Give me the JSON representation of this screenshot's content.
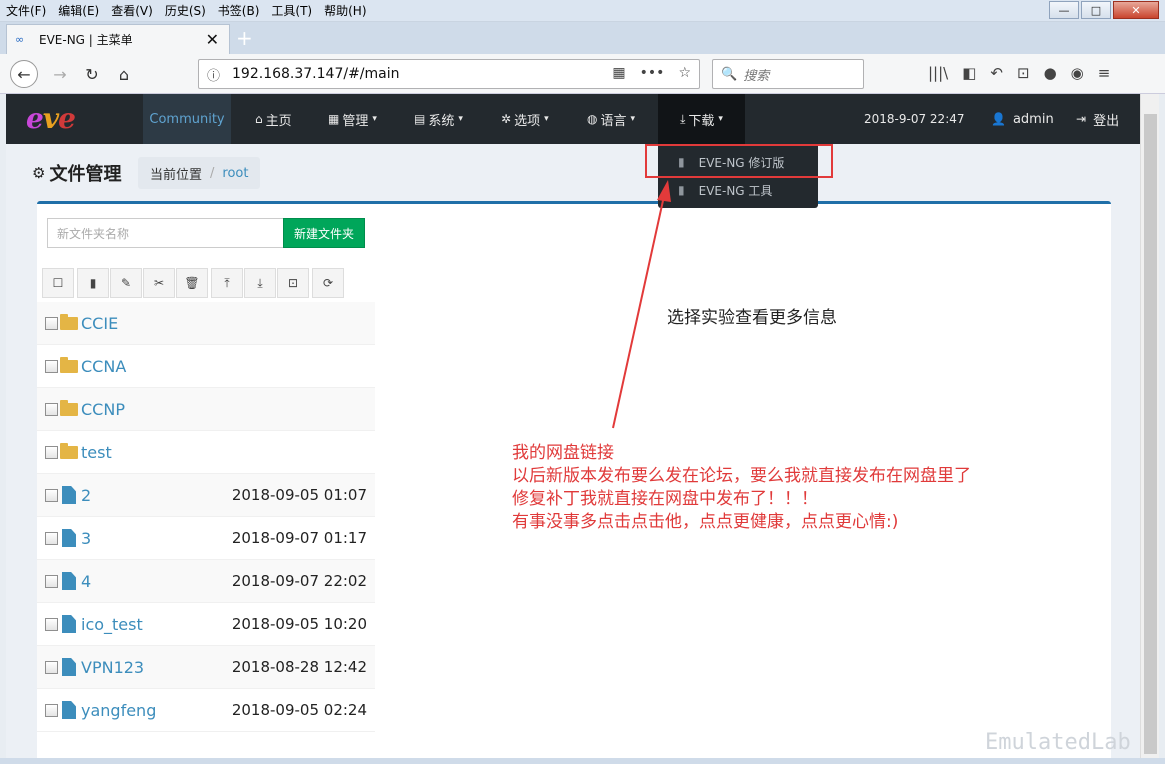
{
  "browser": {
    "menu": [
      "文件(F)",
      "编辑(E)",
      "查看(V)",
      "历史(S)",
      "书签(B)",
      "工具(T)",
      "帮助(H)"
    ],
    "window_controls": [
      "—",
      "□",
      "✕"
    ],
    "tab_title": "EVE-NG | 主菜单",
    "tab_close": "✕",
    "new_tab": "+",
    "url": "192.168.37.147/#/main",
    "search_placeholder": "搜索",
    "url_icons": [
      "▦",
      "•••",
      "☆"
    ],
    "tool_icons": [
      "|||\\",
      "◧",
      "↶",
      "⊡",
      "●",
      "◉",
      "≡"
    ]
  },
  "app": {
    "logo": [
      "e",
      "v",
      "e"
    ],
    "community": "Community",
    "nav": [
      {
        "icon": "⌂",
        "label": "主页"
      },
      {
        "icon": "▦",
        "label": "管理"
      },
      {
        "icon": "▤",
        "label": "系统"
      },
      {
        "icon": "✲",
        "label": "选项"
      },
      {
        "icon": "◍",
        "label": "语言"
      },
      {
        "icon": "⤓",
        "label": "下载"
      }
    ],
    "caret": "▾",
    "datetime": "2018-9-07   22:47",
    "user": "admin",
    "logout": "登出",
    "user_icon": "👤",
    "logout_icon": "⇥",
    "dropdown": [
      "EVE-NG 修订版",
      "EVE-NG 工具"
    ]
  },
  "filemanager": {
    "title": "文件管理",
    "breadcrumb_label": "当前位置",
    "breadcrumb_sep": "/",
    "breadcrumb_root": "root",
    "new_folder_placeholder": "新文件夹名称",
    "new_folder_button": "新建文件夹",
    "toolbar_icons": [
      "☐",
      "▮",
      "✎",
      "✂",
      "🗑",
      "⤒",
      "⤓",
      "⊡",
      "⟳"
    ],
    "items": [
      {
        "type": "folder",
        "name": "CCIE",
        "date": ""
      },
      {
        "type": "folder",
        "name": "CCNA",
        "date": ""
      },
      {
        "type": "folder",
        "name": "CCNP",
        "date": ""
      },
      {
        "type": "folder",
        "name": "test",
        "date": ""
      },
      {
        "type": "file",
        "name": "2",
        "date": "2018-09-05 01:07"
      },
      {
        "type": "file",
        "name": "3",
        "date": "2018-09-07 01:17"
      },
      {
        "type": "file",
        "name": "4",
        "date": "2018-09-07 22:02"
      },
      {
        "type": "file",
        "name": "ico_test",
        "date": "2018-09-05 10:20"
      },
      {
        "type": "file",
        "name": "VPN123",
        "date": "2018-08-28 12:42"
      },
      {
        "type": "file",
        "name": "yangfeng",
        "date": "2018-09-05 02:24"
      }
    ]
  },
  "annotations": {
    "black": "选择实验查看更多信息",
    "red": [
      "我的网盘链接",
      "以后新版本发布要么发在论坛，要么我就直接发布在网盘里了",
      "修复补丁我就直接在网盘中发布了！！！",
      "有事没事多点击点击他，点点更健康，点点更心情:)"
    ]
  },
  "watermark": "EmulatedLab",
  "colors": {
    "accent": "#3c8dbc",
    "header": "#23292e",
    "success": "#00a65a",
    "annotation": "#e03a3a"
  }
}
